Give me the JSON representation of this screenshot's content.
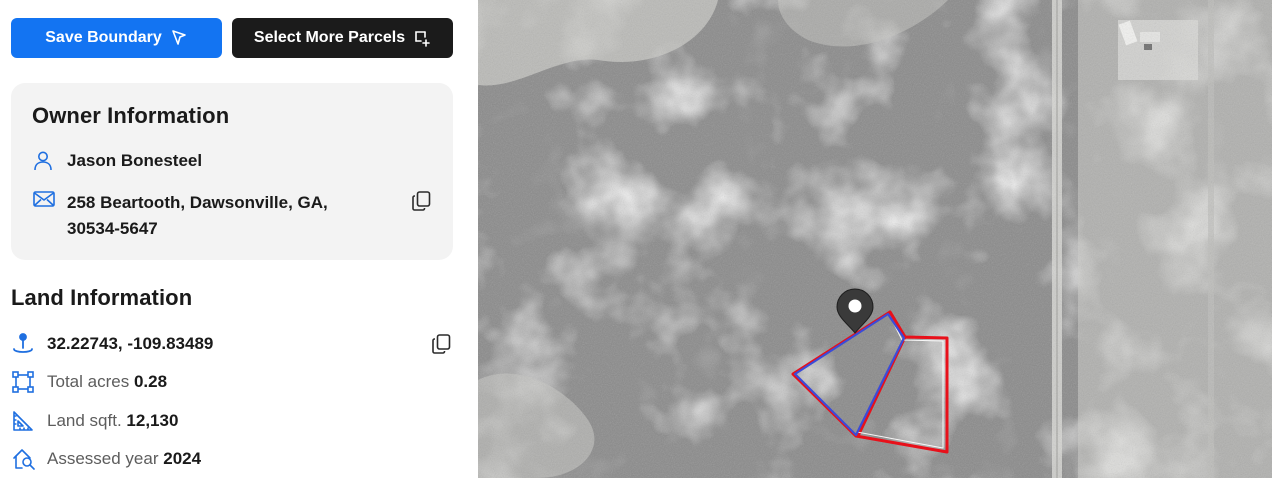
{
  "toolbar": {
    "save_label": "Save Boundary",
    "select_label": "Select More Parcels"
  },
  "owner": {
    "title": "Owner Information",
    "name": "Jason Bonesteel",
    "address_line1": "258 Beartooth, Dawsonville, GA,",
    "address_line2": "30534-5647"
  },
  "land": {
    "title": "Land Information",
    "coordinates": "32.22743, -109.83489",
    "acres_label": "Total acres",
    "acres_value": "0.28",
    "sqft_label": "Land sqft.",
    "sqft_value": "12,130",
    "year_label": "Assessed year",
    "year_value": "2024"
  },
  "colors": {
    "primary": "#1374f2",
    "dark_button": "#1b1b1b",
    "card_bg": "#f3f3f3",
    "icon_blue": "#1f6fe0",
    "parcel_red": "#e8101a",
    "parcel_blue": "#3b4bd8"
  },
  "icons": [
    "cursor-click-icon",
    "select-square-plus-icon",
    "person-icon",
    "mail-icon",
    "copy-icon",
    "location-pin-icon",
    "area-square-icon",
    "ruler-triangle-icon",
    "search-house-icon",
    "map-marker-icon"
  ]
}
